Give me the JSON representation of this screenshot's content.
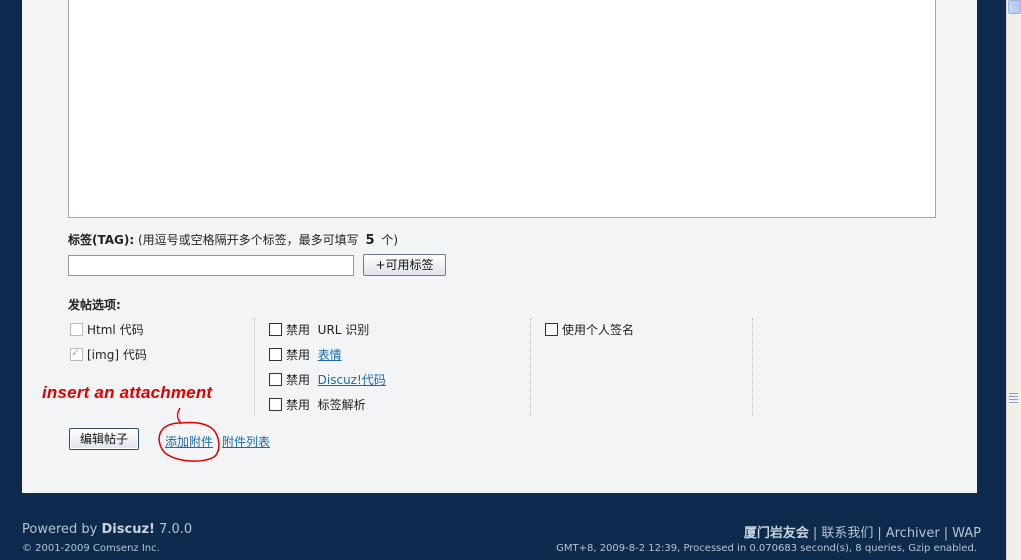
{
  "tags": {
    "label_bold": "标签(TAG):",
    "label_hint": "(用逗号或空格隔开多个标签，最多可填写",
    "max_count": "5",
    "label_suffix": "个)",
    "input_value": "",
    "available_button": "+可用标签"
  },
  "options": {
    "title": "发帖选项:",
    "col1": [
      {
        "label": "Html 代码",
        "checked": false,
        "disabled": true
      },
      {
        "label": "[img] 代码",
        "checked": true,
        "disabled": true
      }
    ],
    "col2": [
      {
        "prefix": "禁用",
        "label": "URL 识别",
        "link": false
      },
      {
        "prefix": "禁用",
        "label": "表情",
        "link": true
      },
      {
        "prefix": "禁用",
        "label": "Discuz!代码",
        "link": true
      },
      {
        "prefix": "禁用",
        "label": "标签解析",
        "link": false
      }
    ],
    "col3": [
      {
        "label": "使用个人签名"
      }
    ]
  },
  "actions": {
    "edit_post": "编辑帖子",
    "add_attachment": "添加附件",
    "attachment_list": "附件列表"
  },
  "annotation": {
    "text": "insert an attachment",
    "color": "#e00000"
  },
  "footer": {
    "powered_prefix": "Powered by",
    "powered_brand": "Discuz!",
    "powered_version": "7.0.0",
    "copyright": "© 2001-2009 Comsenz Inc.",
    "links": [
      "厦门岩友会",
      "联系我们",
      "Archiver",
      "WAP"
    ],
    "stats": "GMT+8, 2009-8-2 12:39, Processed in 0.070683 second(s), 8 queries, Gzip enabled."
  },
  "colors": {
    "page_bg": "#0e2a4d",
    "panel_bg": "#f3f4f5",
    "link": "#1a6aa8"
  }
}
